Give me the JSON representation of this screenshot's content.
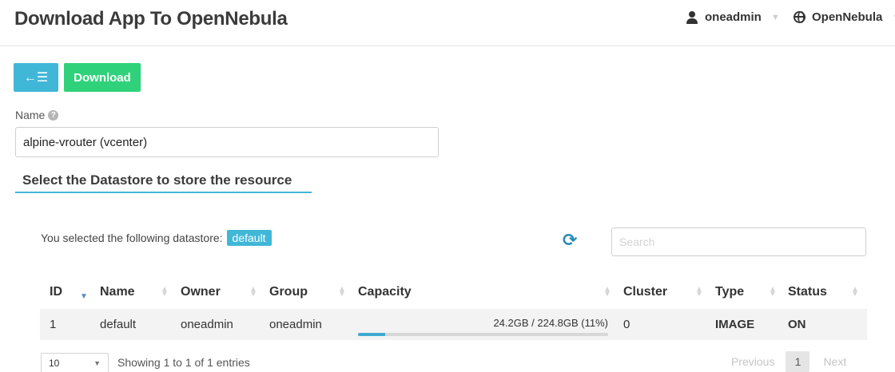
{
  "header": {
    "title": "Download App To OpenNebula",
    "user": "oneadmin",
    "zone": "OpenNebula",
    "user_icon": "user-icon",
    "zone_icon": "globe-icon"
  },
  "toolbar": {
    "back_icon": "back-to-list-icon",
    "back_glyph": "←☰",
    "download_label": "Download"
  },
  "form": {
    "name_label": "Name",
    "name_value": "alpine-vrouter (vcenter)"
  },
  "section": {
    "title": "Select the Datastore to store the resource"
  },
  "selection": {
    "prefix": "You selected the following datastore:",
    "selected": "default"
  },
  "search": {
    "placeholder": "Search"
  },
  "table": {
    "columns": [
      "ID",
      "Name",
      "Owner",
      "Group",
      "Capacity",
      "Cluster",
      "Type",
      "Status"
    ],
    "rows": [
      {
        "id": "1",
        "name": "default",
        "owner": "oneadmin",
        "group": "oneadmin",
        "capacity_text": "24.2GB / 224.8GB (11%)",
        "capacity_fraction": 0.11,
        "cluster": "0",
        "type": "IMAGE",
        "status": "ON"
      }
    ]
  },
  "footer": {
    "page_size": "10",
    "showing": "Showing 1 to 1 of 1 entries",
    "previous": "Previous",
    "current_page": "1",
    "next": "Next"
  },
  "colors": {
    "accent_blue": "#41b7d8",
    "download_green": "#2fd27a",
    "progress_blue": "#3fa9d2"
  }
}
